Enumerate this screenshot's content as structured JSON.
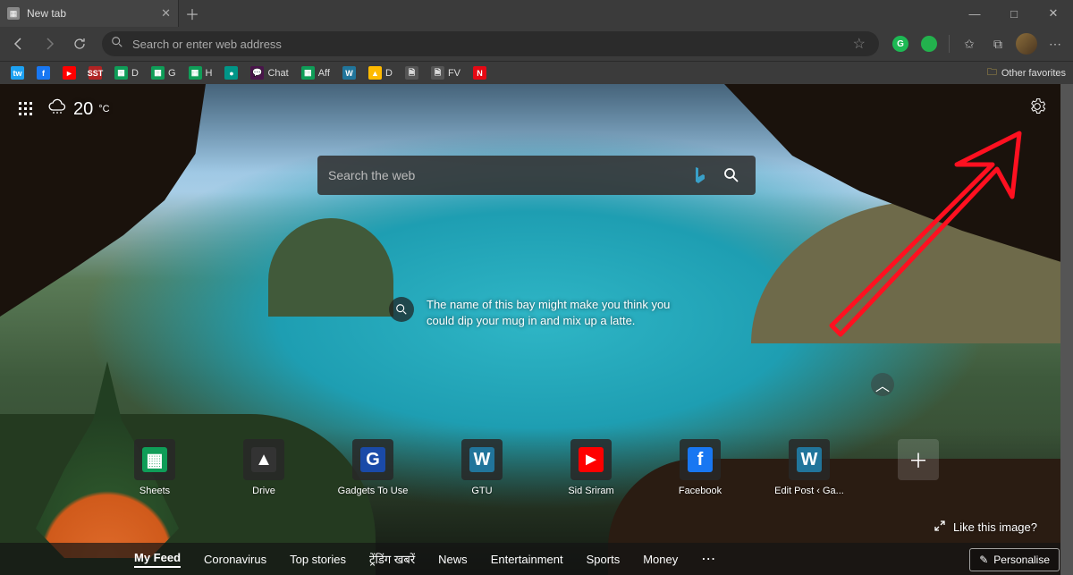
{
  "titlebar": {
    "tab_title": "New tab"
  },
  "toolbar": {
    "addressbar_placeholder": "Search or enter web address"
  },
  "bookmarks": [
    {
      "label": "",
      "icon": "tw",
      "bg": "#1da1f2"
    },
    {
      "label": "",
      "icon": "f",
      "bg": "#1877f2"
    },
    {
      "label": "",
      "icon": "►",
      "bg": "#ff0000"
    },
    {
      "label": "",
      "icon": "SST",
      "bg": "#b02323"
    },
    {
      "label": "D",
      "icon": "▦",
      "bg": "#0f9d58"
    },
    {
      "label": "G",
      "icon": "▦",
      "bg": "#0f9d58"
    },
    {
      "label": "H",
      "icon": "▦",
      "bg": "#0f9d58"
    },
    {
      "label": "",
      "icon": "●",
      "bg": "#009688"
    },
    {
      "label": "Chat",
      "icon": "💬",
      "bg": "#4a154b"
    },
    {
      "label": "Aff",
      "icon": "▦",
      "bg": "#0f9d58"
    },
    {
      "label": "",
      "icon": "W",
      "bg": "#21759b"
    },
    {
      "label": "D",
      "icon": "▲",
      "bg": "#ffba00"
    },
    {
      "label": "",
      "icon": "🗎",
      "bg": "#555"
    },
    {
      "label": "FV",
      "icon": "🗎",
      "bg": "#555"
    },
    {
      "label": "",
      "icon": "N",
      "bg": "#e50914"
    }
  ],
  "other_favorites": "Other favorites",
  "weather": {
    "temp": "20",
    "unit": "°C"
  },
  "search": {
    "placeholder": "Search the web"
  },
  "hint": "The name of this bay might make you think you could dip your mug in and mix up a latte.",
  "tiles": [
    {
      "label": "Sheets",
      "icon": "▦",
      "bg": "#0f9d58"
    },
    {
      "label": "Drive",
      "icon": "▲",
      "bg": "#333"
    },
    {
      "label": "Gadgets To Use",
      "icon": "G",
      "bg": "#1a4aa8"
    },
    {
      "label": "GTU",
      "icon": "W",
      "bg": "#21759b"
    },
    {
      "label": "Sid Sriram",
      "icon": "►",
      "bg": "#ff0000"
    },
    {
      "label": "Facebook",
      "icon": "f",
      "bg": "#1877f2"
    },
    {
      "label": "Edit Post ‹ Ga...",
      "icon": "W",
      "bg": "#21759b"
    }
  ],
  "like_image": "Like this image?",
  "personalise": "Personalise",
  "feed": {
    "items": [
      {
        "label": "My Feed",
        "active": true
      },
      {
        "label": "Coronavirus"
      },
      {
        "label": "Top stories"
      },
      {
        "label": "ट्रेंडिंग खबरें"
      },
      {
        "label": "News"
      },
      {
        "label": "Entertainment"
      },
      {
        "label": "Sports"
      },
      {
        "label": "Money"
      }
    ]
  }
}
